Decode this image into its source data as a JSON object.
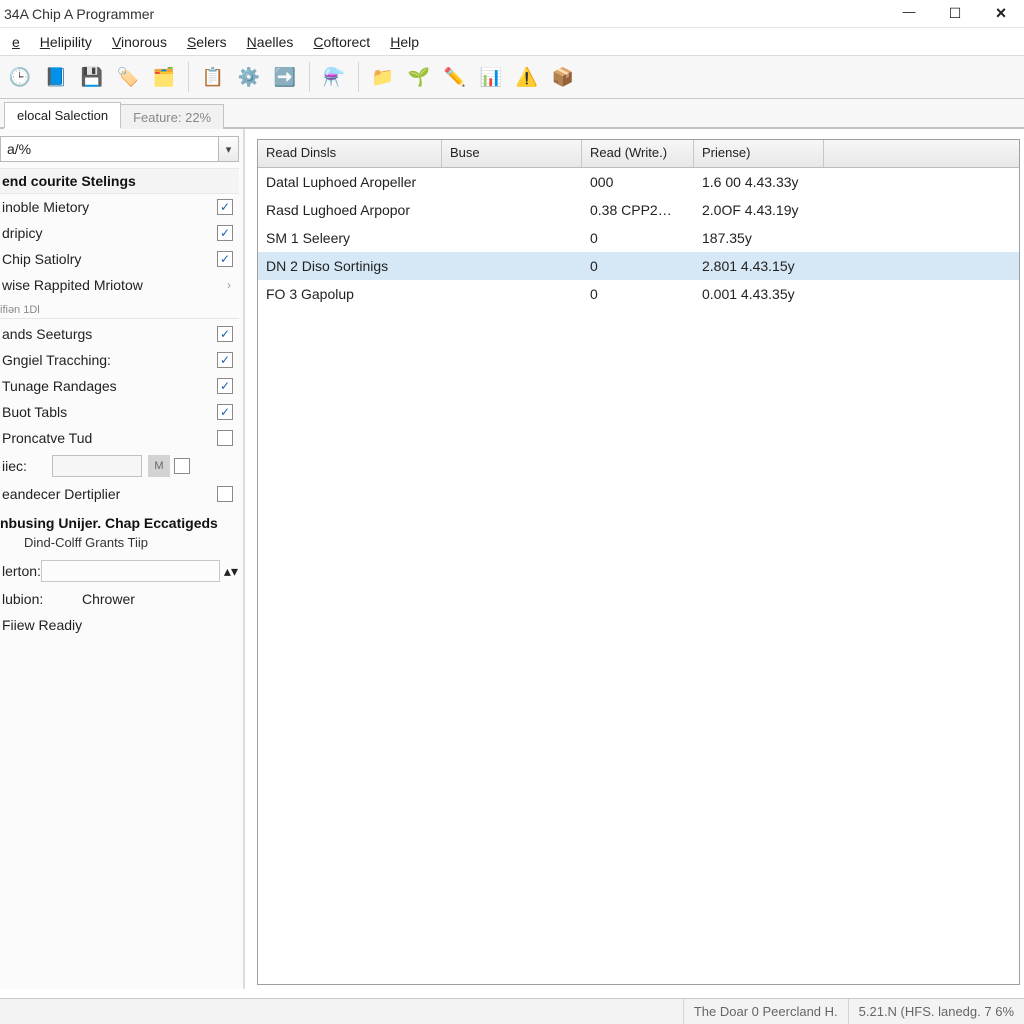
{
  "window": {
    "title": "34A Chip A Programmer"
  },
  "menu": [
    "e",
    "Helipility",
    "Vinorous",
    "Selers",
    "Naelles",
    "Coftorect",
    "Help"
  ],
  "toolbar_icons": [
    {
      "name": "clock-icon",
      "glyph": "🕒"
    },
    {
      "name": "panel-icon",
      "glyph": "📘"
    },
    {
      "name": "disk-icon",
      "glyph": "💾"
    },
    {
      "name": "tag-icon",
      "glyph": "🏷️"
    },
    {
      "name": "new-window-icon",
      "glyph": "🗂️"
    },
    {
      "sep": true
    },
    {
      "name": "calendar-check-icon",
      "glyph": "📋"
    },
    {
      "name": "gear-refresh-icon",
      "glyph": "⚙️"
    },
    {
      "name": "arrow-icon",
      "glyph": "➡️"
    },
    {
      "sep": true
    },
    {
      "name": "funnel-icon",
      "glyph": "⚗️"
    },
    {
      "sep": true
    },
    {
      "name": "folder-gear-icon",
      "glyph": "📁"
    },
    {
      "name": "leaf-icon",
      "glyph": "🌱"
    },
    {
      "name": "wand-icon",
      "glyph": "✏️"
    },
    {
      "name": "chart-icon",
      "glyph": "📊"
    },
    {
      "name": "warning-icon",
      "glyph": "⚠️"
    },
    {
      "name": "box-icon",
      "glyph": "📦"
    }
  ],
  "tabs": {
    "active_label": "elocal Salection",
    "inactive_label": "Feature: 22%"
  },
  "sidebar": {
    "select_value": "a/%",
    "section1_header": "end courite Stelings",
    "group1": [
      {
        "label": "inoble Mietory",
        "checked": true
      },
      {
        "label": "dripicy",
        "checked": true
      },
      {
        "label": "Chip Satiolry",
        "checked": true
      }
    ],
    "rappid_label": "wise Rappited Mriotow",
    "sep_label": "ifiən 1Dl",
    "group2": [
      {
        "label": "ands Seeturgs",
        "checked": true
      },
      {
        "label": "Gngiel Tracching:",
        "checked": true
      },
      {
        "label": "Tunage Randages",
        "checked": true
      },
      {
        "label": "Buot Tabls",
        "checked": true
      },
      {
        "label": "Proncatve Tud",
        "checked": false
      }
    ],
    "iiec_label": "iiec:",
    "iiec_unit": "M",
    "dertiplier": {
      "label": "eandecer Dertiplier",
      "checked": false
    },
    "subhead": "nbusing Unijer. Chap Eccatigeds",
    "sublabel": "Dind-Colff Grants Tiip",
    "lerton_label": "lerton:",
    "lubon_label": "lubion:",
    "lubon_value": "Chrower",
    "fiew_label": "Fiiew Readiy"
  },
  "grid": {
    "columns": [
      "Read Dinsls",
      "Buse",
      "Read (Write.)",
      "Priense)"
    ],
    "rows": [
      {
        "c0": "Datal Luphoed Aropeller",
        "c1": "",
        "c2": "000",
        "c3": "1.6 00 4.43.33y",
        "sel": false
      },
      {
        "c0": "Rasd Lughoed Arpopor",
        "c1": "",
        "c2": "0.38 CPP2…",
        "c3": "2.0OF 4.43.19y",
        "sel": false
      },
      {
        "c0": "SM 1 Seleery",
        "c1": "",
        "c2": "0",
        "c3": "187.35y",
        "sel": false
      },
      {
        "c0": "DN 2 Diso Sortinigs",
        "c1": "",
        "c2": "0",
        "c3": "2.801 4.43.15y",
        "sel": true
      },
      {
        "c0": "FO 3 Gapolup",
        "c1": "",
        "c2": "0",
        "c3": "0.001 4.43.35y",
        "sel": false
      }
    ]
  },
  "statusbar": {
    "cell1": "The Doar 0 Peercland H.",
    "cell2": "5.21.N (HFS. lanedg. 7 6%"
  }
}
